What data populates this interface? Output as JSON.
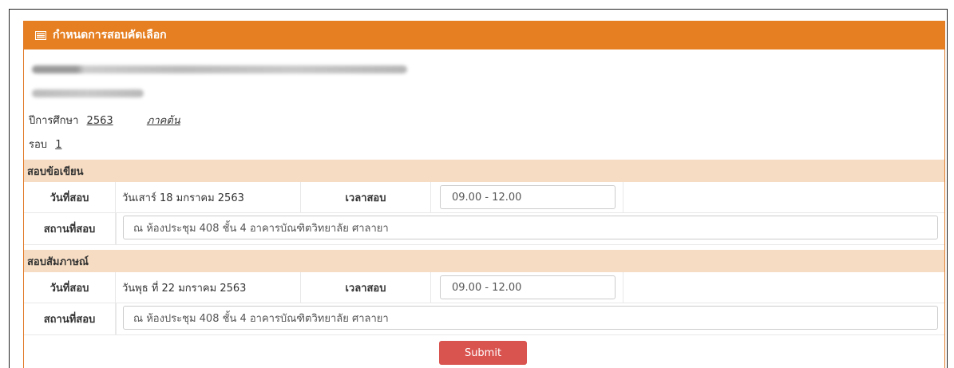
{
  "panel": {
    "title": "กำหนดการสอบคัดเลือก",
    "icon": "list-icon"
  },
  "academic": {
    "year_label": "ปีการศึกษา",
    "year_value": "2563",
    "semester": "ภาคต้น",
    "round_label": "รอบ",
    "round_value": "1"
  },
  "written_exam": {
    "section_title": "สอบข้อเขียน",
    "date_label": "วันที่สอบ",
    "date_value": "วันเสาร์ 18 มกราคม 2563",
    "time_label": "เวลาสอบ",
    "time_value": "09.00 - 12.00",
    "place_label": "สถานที่สอบ",
    "place_value": "ณ ห้องประชุม 408 ชั้น 4 อาคารบัณฑิตวิทยาลัย ศาลายา"
  },
  "interview": {
    "section_title": "สอบสัมภาษณ์",
    "date_label": "วันที่สอบ",
    "date_value": "วันพุธ ที่ 22 มกราคม 2563",
    "time_label": "เวลาสอบ",
    "time_value": "09.00 - 12.00",
    "place_label": "สถานที่สอบ",
    "place_value": "ณ ห้องประชุม 408 ชั้น 4 อาคารบัณฑิตวิทยาลัย ศาลายา"
  },
  "submit_label": "Submit",
  "colors": {
    "header": "#e57f22",
    "section": "#f6dcc2",
    "submit": "#d9534f"
  }
}
